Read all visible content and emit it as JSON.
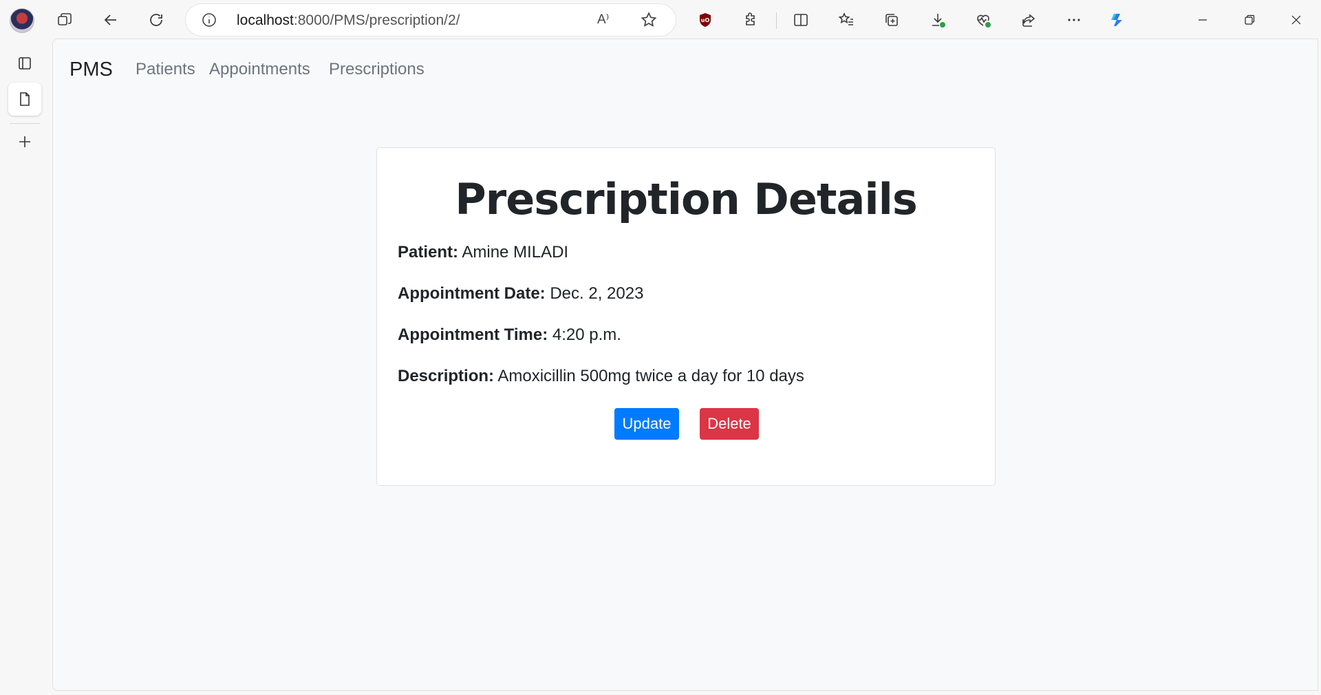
{
  "browser": {
    "url_host": "localhost",
    "url_path": ":8000/PMS/prescription/2/",
    "read_aloud_label": "A⁾"
  },
  "navbar": {
    "brand": "PMS",
    "links": [
      "Patients",
      "Appointments",
      "Prescriptions"
    ]
  },
  "card": {
    "title": "Prescription Details",
    "fields": [
      {
        "label": "Patient:",
        "value": "Amine MILADI"
      },
      {
        "label": "Appointment Date:",
        "value": "Dec. 2, 2023"
      },
      {
        "label": "Appointment Time:",
        "value": "4:20 p.m."
      },
      {
        "label": "Description:",
        "value": "Amoxicillin 500mg twice a day for 10 days"
      }
    ],
    "update_label": "Update",
    "delete_label": "Delete"
  },
  "colors": {
    "primary": "#007bff",
    "danger": "#dc3545",
    "page_bg": "#f8f9fa"
  },
  "icons": {
    "toolbar": [
      "workspaces-icon",
      "back-icon",
      "refresh-icon",
      "ublock-icon",
      "extensions-icon",
      "split-screen-icon",
      "favorites-icon",
      "collections-icon",
      "downloads-icon",
      "browser-essentials-icon",
      "share-icon",
      "more-icon",
      "copilot-icon"
    ],
    "sidebar": [
      "tab-actions-icon",
      "page-tab-icon",
      "new-tab-icon"
    ]
  }
}
